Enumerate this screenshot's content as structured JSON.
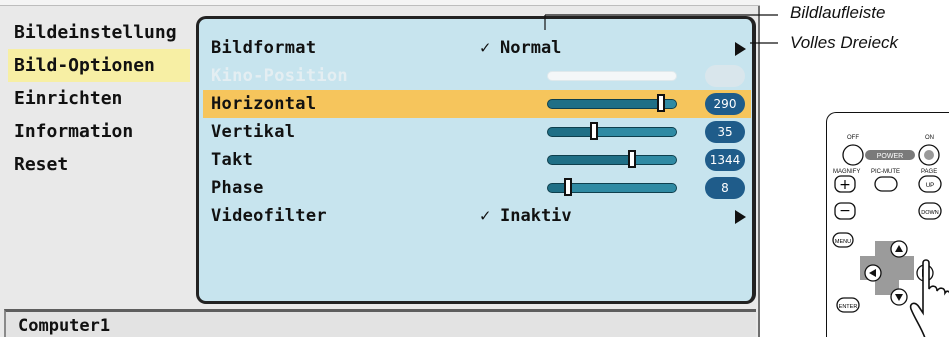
{
  "menu": {
    "categories": [
      {
        "label": "Bildeinstellung",
        "selected": false
      },
      {
        "label": "Bild-Optionen",
        "selected": true
      },
      {
        "label": "Einrichten",
        "selected": false
      },
      {
        "label": "Information",
        "selected": false
      },
      {
        "label": "Reset",
        "selected": false
      }
    ],
    "items": [
      {
        "label": "Bildformat",
        "check": "✓",
        "value": "Normal",
        "has_submenu": true
      },
      {
        "label": "Kino-Position",
        "disabled": true,
        "slider_level": null
      },
      {
        "label": "Horizontal",
        "selected": true,
        "slider_level": 0.88,
        "value": "290"
      },
      {
        "label": "Vertikal",
        "slider_level": 0.36,
        "value": "35"
      },
      {
        "label": "Takt",
        "slider_level": 0.66,
        "value": "1344"
      },
      {
        "label": "Phase",
        "slider_level": 0.16,
        "value": "8"
      },
      {
        "label": "Videofilter",
        "check": "✓",
        "value": "Inaktiv",
        "has_submenu": true
      }
    ],
    "status": "Computer1",
    "colors": {
      "selected_category": "#f7efa4",
      "selected_item": "#f6c55c",
      "panel_bg": "#c7e4ee",
      "badge": "#1f5c8a",
      "slider": "#1f6f86"
    }
  },
  "annotations": {
    "scrollbar": "Bildlaufleiste",
    "full_triangle": "Volles Dreieck"
  },
  "remote": {
    "labels": {
      "off": "OFF",
      "on": "ON",
      "power": "POWER",
      "magnify": "MAGNIFY",
      "pic_mute": "PIC-MUTE",
      "page": "PAGE",
      "up": "UP",
      "down": "DOWN",
      "menu": "MENU",
      "enter": "ENTER"
    }
  }
}
